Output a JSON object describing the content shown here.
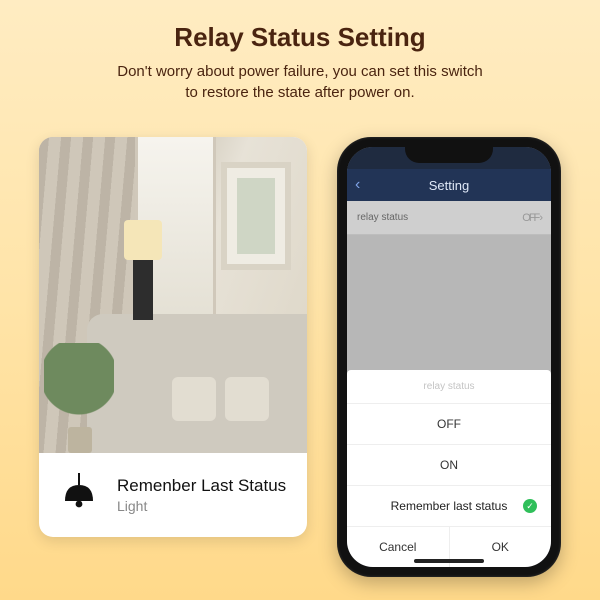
{
  "header": {
    "title": "Relay Status Setting",
    "subtitle_line1": "Don't worry about power failure, you can set this switch",
    "subtitle_line2": "to restore the state after power on."
  },
  "card": {
    "title": "Remenber Last Status",
    "subtitle": "Light"
  },
  "phone": {
    "nav_title": "Setting",
    "row_label": "relay status",
    "row_value": "OFF",
    "sheet": {
      "title": "relay status",
      "options": [
        "OFF",
        "ON",
        "Remember last status"
      ],
      "selected_index": 2,
      "cancel": "Cancel",
      "ok": "OK"
    }
  }
}
